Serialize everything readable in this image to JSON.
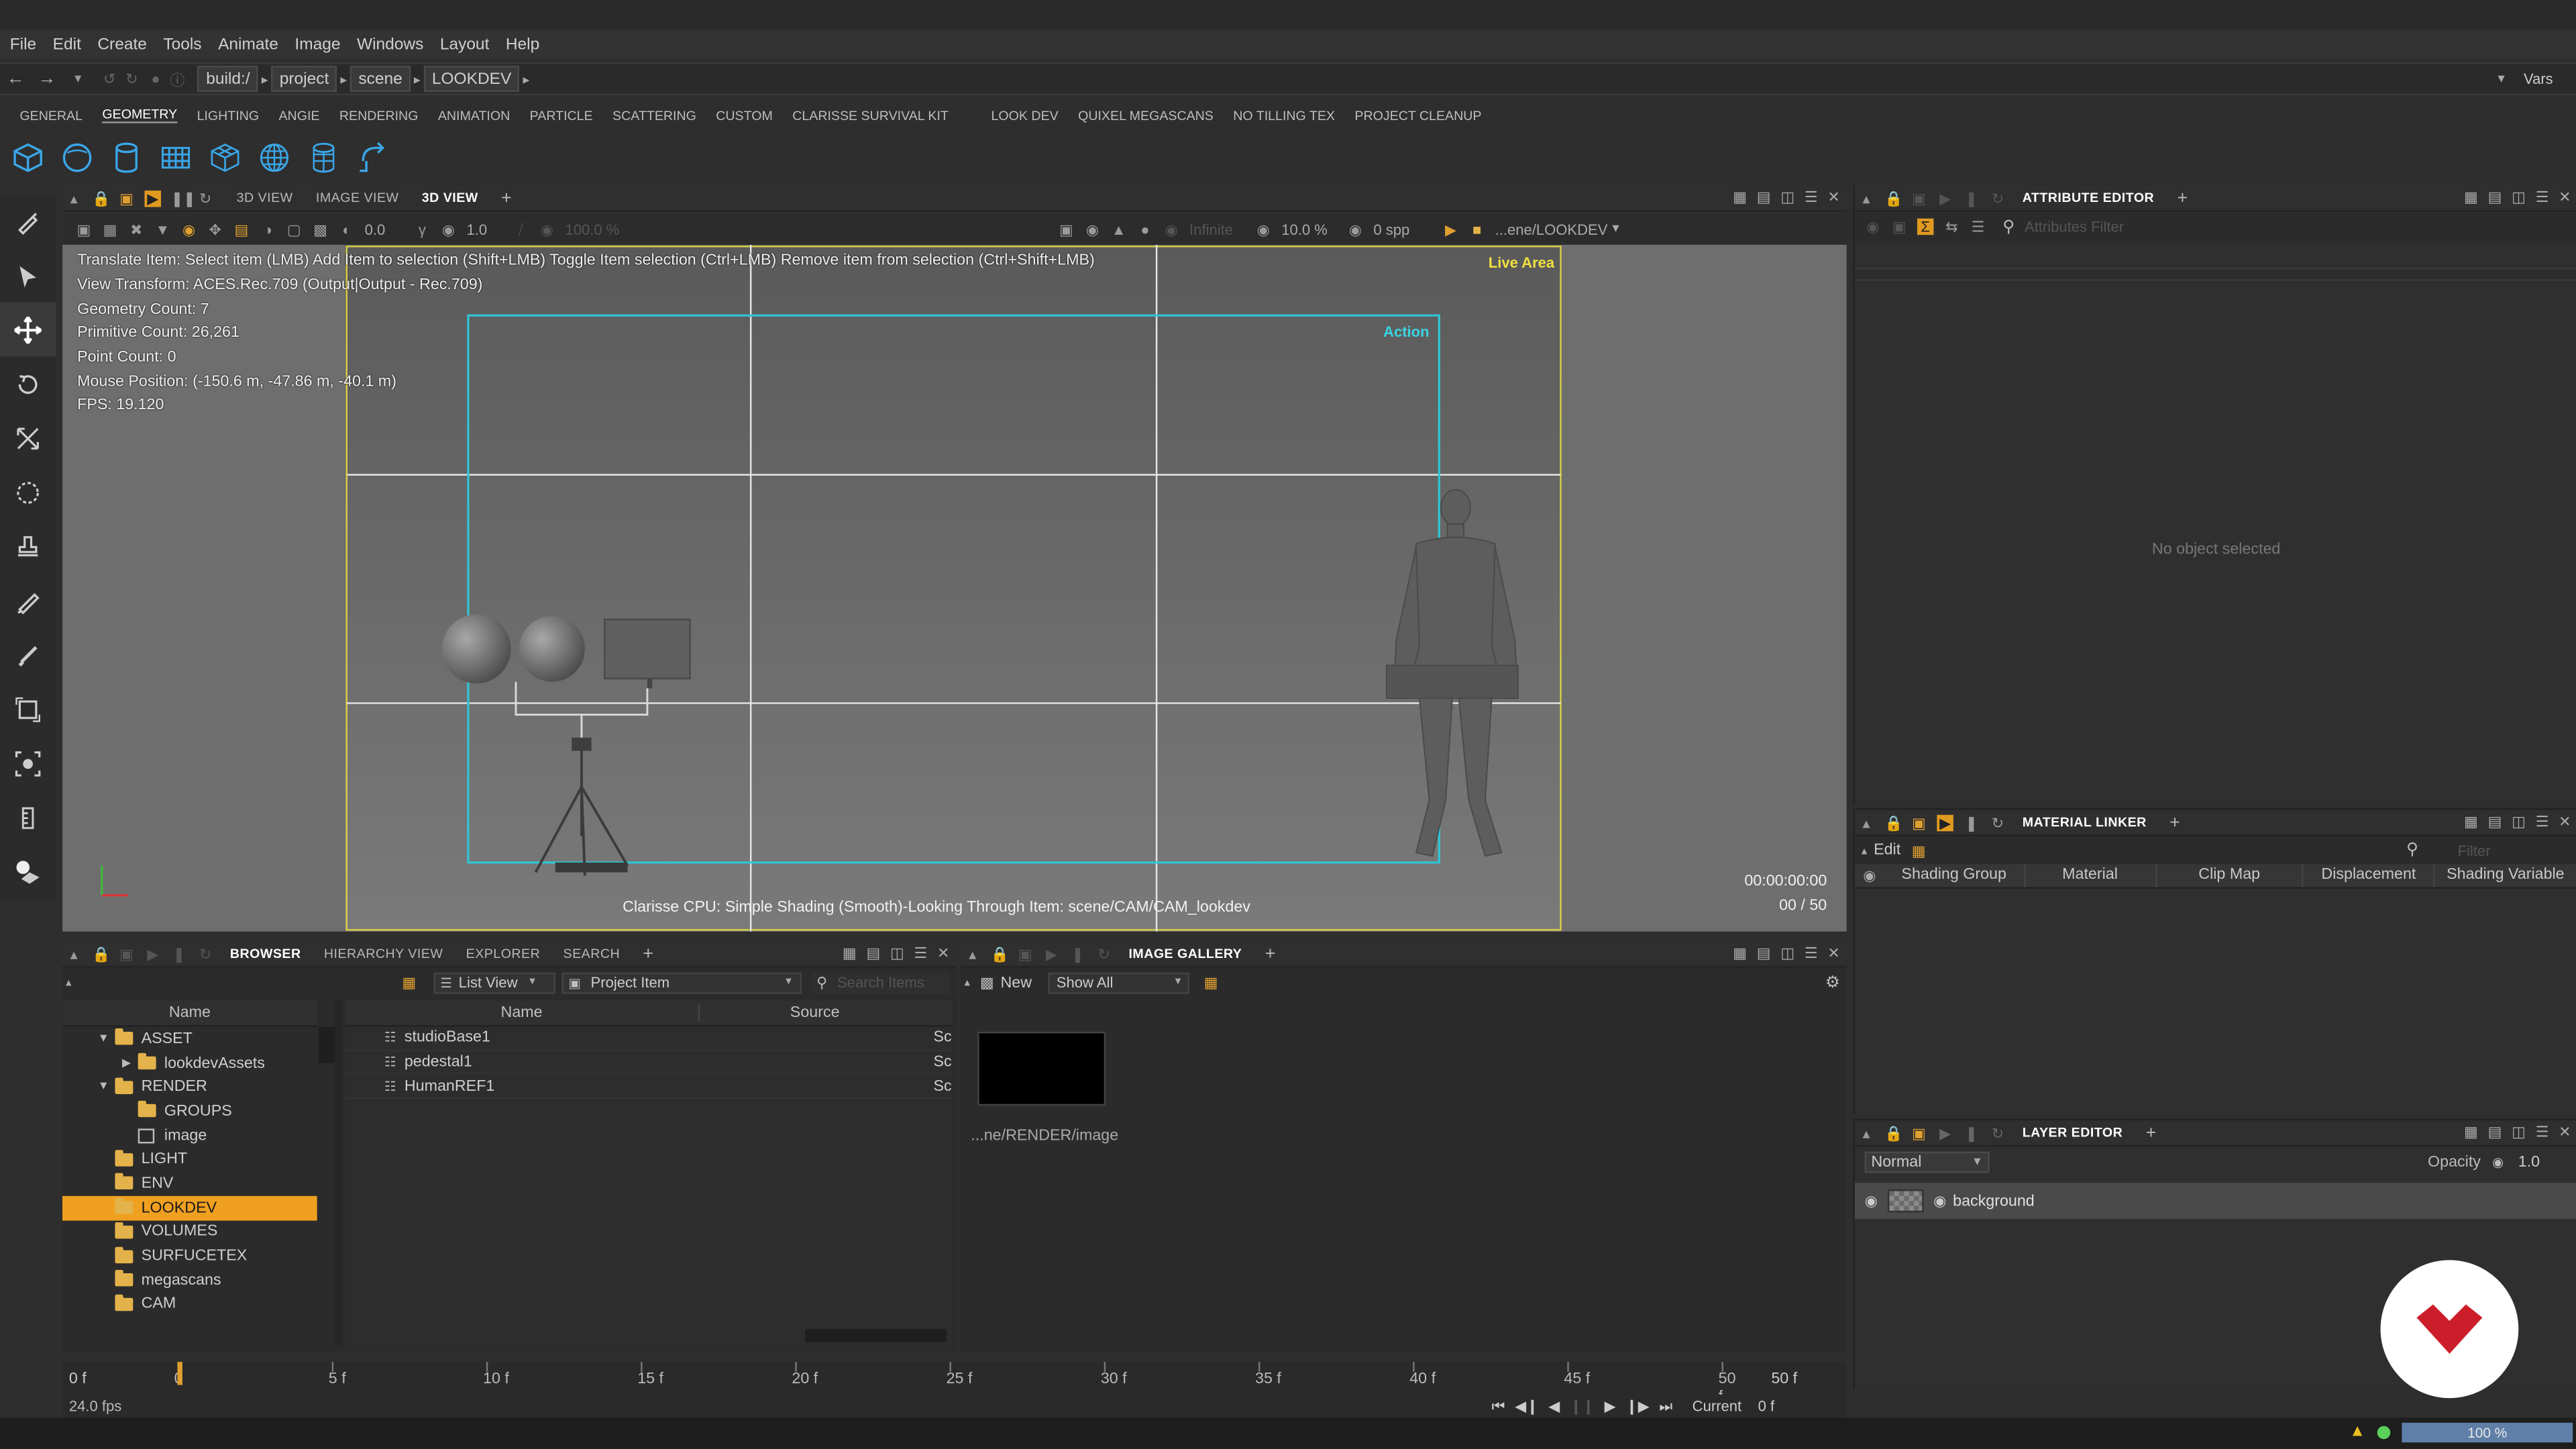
{
  "menu": [
    "File",
    "Edit",
    "Create",
    "Tools",
    "Animate",
    "Image",
    "Windows",
    "Layout",
    "Help"
  ],
  "address": {
    "crumbs": [
      "build:/",
      "project",
      "scene",
      "LOOKDEV"
    ],
    "vars_label": "Vars"
  },
  "shelf_tabs": [
    "GENERAL",
    "GEOMETRY",
    "LIGHTING",
    "ANGIE",
    "RENDERING",
    "ANIMATION",
    "PARTICLE",
    "SCATTERING",
    "CUSTOM",
    "CLARISSE SURVIVAL KIT",
    "LOOK DEV",
    "QUIXEL MEGASCANS",
    "NO TILLING TEX",
    "PROJECT CLEANUP"
  ],
  "shelf_active": "GEOMETRY",
  "shelf_icons": [
    "cube-icon",
    "sphere-icon",
    "cylinder-icon",
    "grid-icon",
    "box-grid-icon",
    "globe-grid-icon",
    "cylinder-grid-icon",
    "import-icon"
  ],
  "viewport_tabs": [
    "3D VIEW",
    "IMAGE VIEW",
    "3D VIEW"
  ],
  "viewport_toolbar": {
    "value1": "0.0",
    "value2": "1.0",
    "value3": "100.0 %",
    "infinite": "Infinite",
    "zoom": "10.0 %",
    "spp": "0 spp",
    "path": "...ene/LOOKDEV"
  },
  "viewport": {
    "hint": "Translate Item: Select item (LMB)  Add Item to selection (Shift+LMB)  Toggle Item selection (Ctrl+LMB)  Remove item from selection (Ctrl+Shift+LMB)",
    "view_transform": "View Transform: ACES.Rec.709 (Output|Output - Rec.709)",
    "geometry_count": "Geometry Count: 7",
    "primitive_count": "Primitive Count: 26,261",
    "point_count": "Point Count: 0",
    "mouse_position": "Mouse Position:  (-150.6 m, -47.86 m, -40.1 m)",
    "fps": "FPS: 19.120",
    "live_area": "Live Area",
    "action": "Action",
    "render_status": "Clarisse CPU: Simple Shading (Smooth)-Looking Through Item: scene/CAM/CAM_lookdev",
    "timecode": "00:00:00:00",
    "frames": "00 / 50"
  },
  "attribute_editor": {
    "title": "ATTRIBUTE EDITOR",
    "filter_placeholder": "Attributes Filter",
    "empty": "No object selected"
  },
  "material_linker": {
    "title": "MATERIAL LINKER",
    "edit": "Edit",
    "filter_placeholder": "Filter",
    "columns": [
      "Shading Group",
      "Material",
      "Clip Map",
      "Displacement",
      "Shading Variable"
    ]
  },
  "layer_editor": {
    "title": "LAYER EDITOR",
    "blend": "Normal",
    "opacity_label": "Opacity",
    "opacity": "1.0",
    "layers": [
      "background"
    ]
  },
  "browser": {
    "tabs": [
      "BROWSER",
      "HIERARCHY VIEW",
      "EXPLORER",
      "SEARCH"
    ],
    "view_mode": "List View",
    "filter": "Project Item",
    "search_placeholder": "Search Items",
    "tree_header": "Name",
    "tree": [
      {
        "label": "ASSET",
        "indent": 1,
        "expand": "down"
      },
      {
        "label": "lookdevAssets",
        "indent": 2,
        "expand": "right"
      },
      {
        "label": "RENDER",
        "indent": 1,
        "expand": "down"
      },
      {
        "label": "GROUPS",
        "indent": 2,
        "expand": ""
      },
      {
        "label": "image",
        "indent": 2,
        "expand": "",
        "kind": "image"
      },
      {
        "label": "LIGHT",
        "indent": 1,
        "expand": ""
      },
      {
        "label": "ENV",
        "indent": 1,
        "expand": ""
      },
      {
        "label": "LOOKDEV",
        "indent": 1,
        "expand": "",
        "selected": true
      },
      {
        "label": "VOLUMES",
        "indent": 1,
        "expand": ""
      },
      {
        "label": "SURFUCETEX",
        "indent": 1,
        "expand": ""
      },
      {
        "label": "megascans",
        "indent": 1,
        "expand": ""
      },
      {
        "label": "CAM",
        "indent": 1,
        "expand": ""
      }
    ],
    "list_columns": [
      "Name",
      "Source"
    ],
    "items": [
      {
        "name": "studioBase1",
        "source": "Sc"
      },
      {
        "name": "pedestal1",
        "source": "Sc"
      },
      {
        "name": "HumanREF1",
        "source": "Sc"
      }
    ]
  },
  "image_gallery": {
    "title": "IMAGE GALLERY",
    "new_label": "New",
    "show": "Show All",
    "caption": "...ne/RENDER/image"
  },
  "timeline": {
    "start": "0 f",
    "ticks": [
      "0",
      "5 f",
      "10 f",
      "15 f",
      "20 f",
      "25 f",
      "30 f",
      "35 f",
      "40 f",
      "45 f",
      "50 f"
    ],
    "end": "50 f",
    "fps": "24.0 fps",
    "current_label": "Current",
    "current": "0 f"
  },
  "status": {
    "zoom": "100 %"
  },
  "colors": {
    "accent": "#f0a020",
    "safe_frame": "#2fc6d6",
    "live_area": "#d8cf4a",
    "logo_red": "#cc1e2a"
  }
}
